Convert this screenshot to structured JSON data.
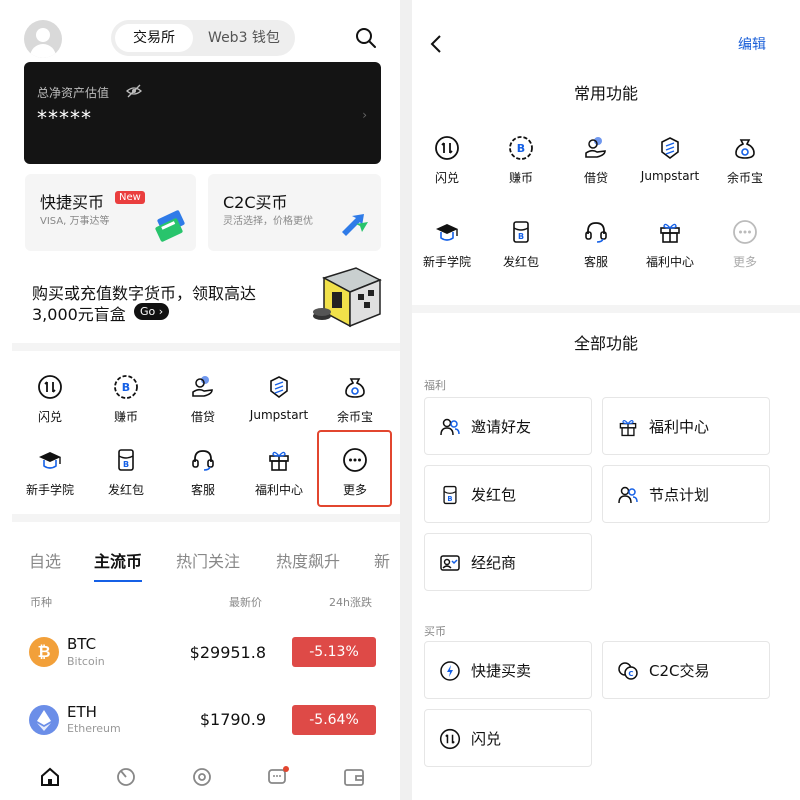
{
  "left": {
    "header": {
      "tab_exchange": "交易所",
      "tab_wallet": "Web3 钱包"
    },
    "asset": {
      "label": "总净资产估值",
      "value": "*****",
      "arrow": "›"
    },
    "buy_cards": [
      {
        "title": "快捷买币",
        "badge": "New",
        "sub": "VISA, 万事达等"
      },
      {
        "title": "C2C买币",
        "sub": "灵活选择，价格更优"
      }
    ],
    "promo": {
      "line1": "购买或充值数字货币，领取高达",
      "line2": "3,000元盲盒",
      "go": "Go"
    },
    "functions": [
      "闪兑",
      "赚币",
      "借贷",
      "Jumpstart",
      "余币宝",
      "新手学院",
      "发红包",
      "客服",
      "福利中心",
      "更多"
    ],
    "market_tabs": [
      "自选",
      "主流币",
      "热门关注",
      "热度飙升",
      "新"
    ],
    "columns": {
      "coin": "币种",
      "price": "最新价",
      "change": "24h涨跌"
    },
    "coins": [
      {
        "symbol": "BTC",
        "name": "Bitcoin",
        "price": "$29951.8",
        "change": "-5.13%"
      },
      {
        "symbol": "ETH",
        "name": "Ethereum",
        "price": "$1790.9",
        "change": "-5.64%"
      }
    ],
    "colors": {
      "accent": "#1560e6",
      "down": "#de4a47",
      "highlight": "#e2462f"
    }
  },
  "right": {
    "edit": "编辑",
    "common_title": "常用功能",
    "common": [
      "闪兑",
      "赚币",
      "借贷",
      "Jumpstart",
      "余币宝",
      "新手学院",
      "发红包",
      "客服",
      "福利中心",
      "更多"
    ],
    "all_title": "全部功能",
    "sections": [
      {
        "title": "福利",
        "items": [
          "邀请好友",
          "福利中心",
          "发红包",
          "节点计划",
          "经纪商"
        ]
      },
      {
        "title": "买币",
        "items": [
          "快捷买卖",
          "C2C交易",
          "闪兑"
        ]
      }
    ]
  }
}
